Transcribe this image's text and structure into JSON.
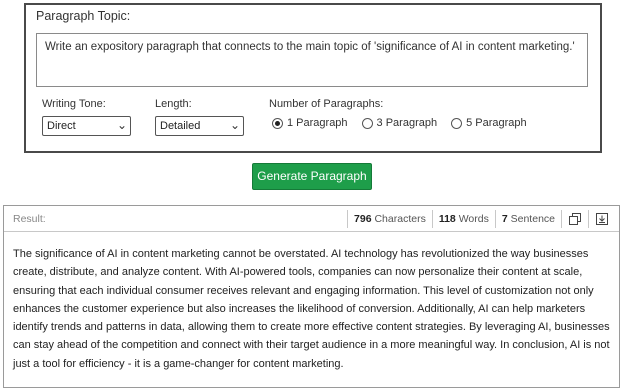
{
  "form": {
    "topic_label": "Paragraph Topic:",
    "topic_value": "Write an expository paragraph that connects to the main topic of 'significance of AI in content marketing.'",
    "tone_label": "Writing Tone:",
    "tone_value": "Direct",
    "length_label": "Length:",
    "length_value": "Detailed",
    "num_label": "Number of Paragraphs:",
    "num_options": [
      {
        "label": "1 Paragraph",
        "selected": true
      },
      {
        "label": "3 Paragraph",
        "selected": false
      },
      {
        "label": "5 Paragraph",
        "selected": false
      }
    ]
  },
  "generate_label": "Generate Paragraph",
  "result": {
    "label": "Result:",
    "characters_count": "796",
    "characters_label": "Characters",
    "words_count": "118",
    "words_label": "Words",
    "sentence_count": "7",
    "sentence_label": "Sentence",
    "copy_icon": "copy-icon",
    "download_icon": "download-icon",
    "text": "The significance of AI in content marketing cannot be overstated. AI technology has revolutionized the way businesses create, distribute, and analyze content. With AI-powered tools, companies can now personalize their content at scale, ensuring that each individual consumer receives relevant and engaging information. This level of customization not only enhances the customer experience but also increases the likelihood of conversion. Additionally, AI can help marketers identify trends and patterns in data, allowing them to create more effective content strategies. By leveraging AI, businesses can stay ahead of the competition and connect with their target audience in a more meaningful way. In conclusion, AI is not just a tool for efficiency - it is a game-changer for content marketing."
  }
}
